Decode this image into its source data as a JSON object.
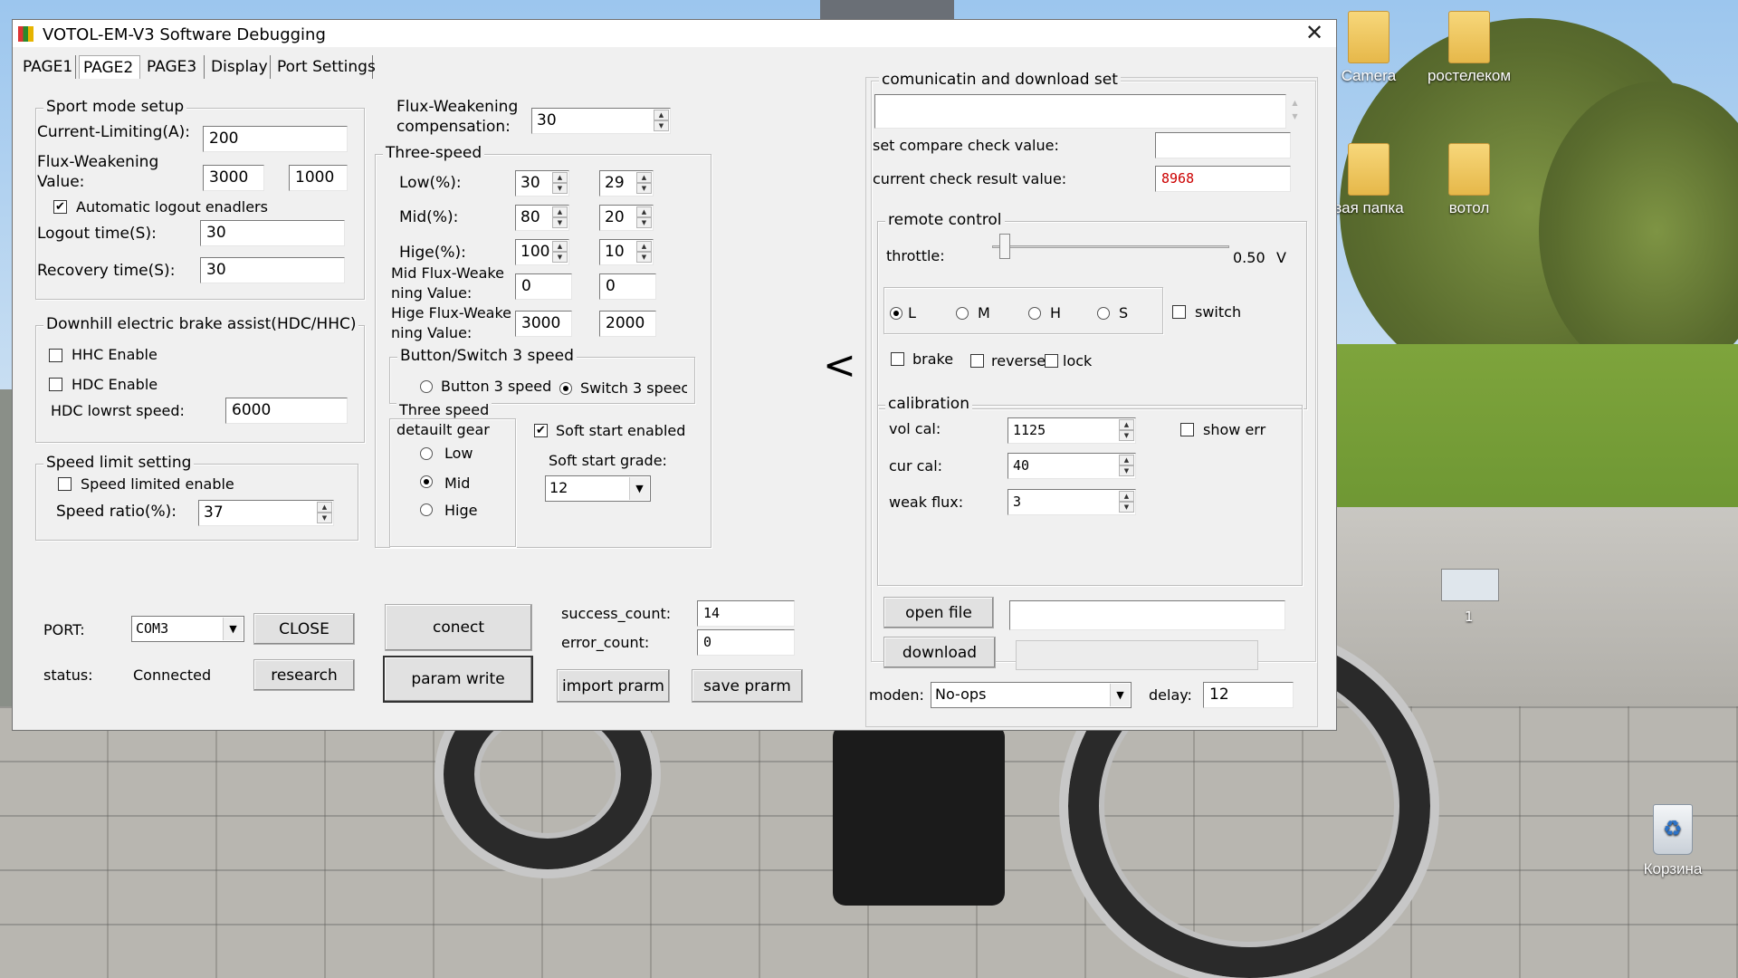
{
  "desktop": {
    "icons": [
      {
        "label": "Camera"
      },
      {
        "label": "ростелеком"
      },
      {
        "label": "вая папка"
      },
      {
        "label": "вотол"
      },
      {
        "label": "Корзина"
      }
    ],
    "thumb_label": "1"
  },
  "window": {
    "title": "VOTOL-EM-V3 Software Debugging",
    "close_symbol": "✕",
    "tabs": [
      "PAGE1",
      "PAGE2",
      "PAGE3",
      "Display",
      "Port Settings"
    ]
  },
  "sport_mode": {
    "title": "Sport mode setup",
    "current_limit_label": "Current-Limiting(A):",
    "current_limit_value": "200",
    "flux_value_label_1": "Flux-Weakening",
    "flux_value_label_2": "Value:",
    "flux_value_1": "3000",
    "flux_value_2": "1000",
    "auto_logout_label": "Automatic logout enadlers",
    "auto_logout_checked": true,
    "logout_time_label": "Logout time(S):",
    "logout_time_value": "30",
    "recovery_time_label": "Recovery time(S):",
    "recovery_time_value": "30"
  },
  "downhill": {
    "title": "Downhill electric brake assist(HDC/HHC)",
    "hhc_label": "HHC Enable",
    "hdc_label": "HDC Enable",
    "hdc_speed_label": "HDC lowrst speed:",
    "hdc_speed_value": "6000"
  },
  "speed_limit": {
    "title": "Speed limit setting",
    "enable_label": "Speed limited enable",
    "ratio_label": "Speed ratio(%):",
    "ratio_value": "37"
  },
  "flux_comp": {
    "label_1": "Flux-Weakening",
    "label_2": "compensation:",
    "value": "30"
  },
  "three_speed": {
    "title": "Three-speed",
    "low_label": "Low(%):",
    "low_a": "30",
    "low_b": "29",
    "mid_label": "Mid(%):",
    "mid_a": "80",
    "mid_b": "20",
    "hige_label": "Hige(%):",
    "hige_a": "100",
    "hige_b": "10",
    "mid_flux_label_1": "Mid Flux-Weake",
    "mid_flux_label_2": "ning Value:",
    "mid_flux_a": "0",
    "mid_flux_b": "0",
    "hige_flux_label_1": "Hige Flux-Weake",
    "hige_flux_label_2": "ning Value:",
    "hige_flux_a": "3000",
    "hige_flux_b": "2000"
  },
  "button_switch": {
    "title": "Button/Switch 3 speed",
    "button_label": "Button 3 speed",
    "switch_label": "Switch 3 speec",
    "selected": "switch"
  },
  "default_gear": {
    "title_1": "Three speed",
    "title_2": "detauilt gear",
    "low": "Low",
    "mid": "Mid",
    "hige": "Hige",
    "selected": "mid"
  },
  "soft_start": {
    "enabled_label": "Soft start enabled",
    "enabled_checked": true,
    "grade_label": "Soft start grade:",
    "grade_value": "12"
  },
  "port": {
    "port_label": "PORT:",
    "port_value": "COM3",
    "close_button": "CLOSE",
    "status_label": "status:",
    "status_value": "Connected",
    "research_button": "research",
    "connect_button": "conect",
    "param_write_button": "param write",
    "success_label": "success_count:",
    "success_value": "14",
    "error_label": "error_count:",
    "error_value": "0",
    "import_button": "import prarm",
    "save_button": "save prarm"
  },
  "collapse_arrow": "<",
  "comm": {
    "title": "comunicatin and download set",
    "compare_label": "set compare check value:",
    "compare_value": "",
    "result_label": "current check result value:",
    "result_value": "8968"
  },
  "remote": {
    "title": "remote control",
    "throttle_label": "throttle:",
    "throttle_value": "0.50",
    "throttle_unit": "V",
    "throttle_fraction": 0.04,
    "gears": [
      "L",
      "M",
      "H",
      "S"
    ],
    "selected_gear": "L",
    "switch_label": "switch",
    "brake_label": "brake",
    "reverse_label": "reverse",
    "lock_label": "lock"
  },
  "calibration": {
    "title": "calibration",
    "vol_label": "vol cal:",
    "vol_value": "1125",
    "cur_label": "cur cal:",
    "cur_value": "40",
    "weak_label": "weak flux:",
    "weak_value": "3",
    "show_err_label": "show err"
  },
  "download": {
    "open_file_button": "open file",
    "file_path": "",
    "download_button": "download",
    "moden_label": "moden:",
    "moden_value": "No-ops",
    "delay_label": "delay:",
    "delay_value": "12"
  }
}
